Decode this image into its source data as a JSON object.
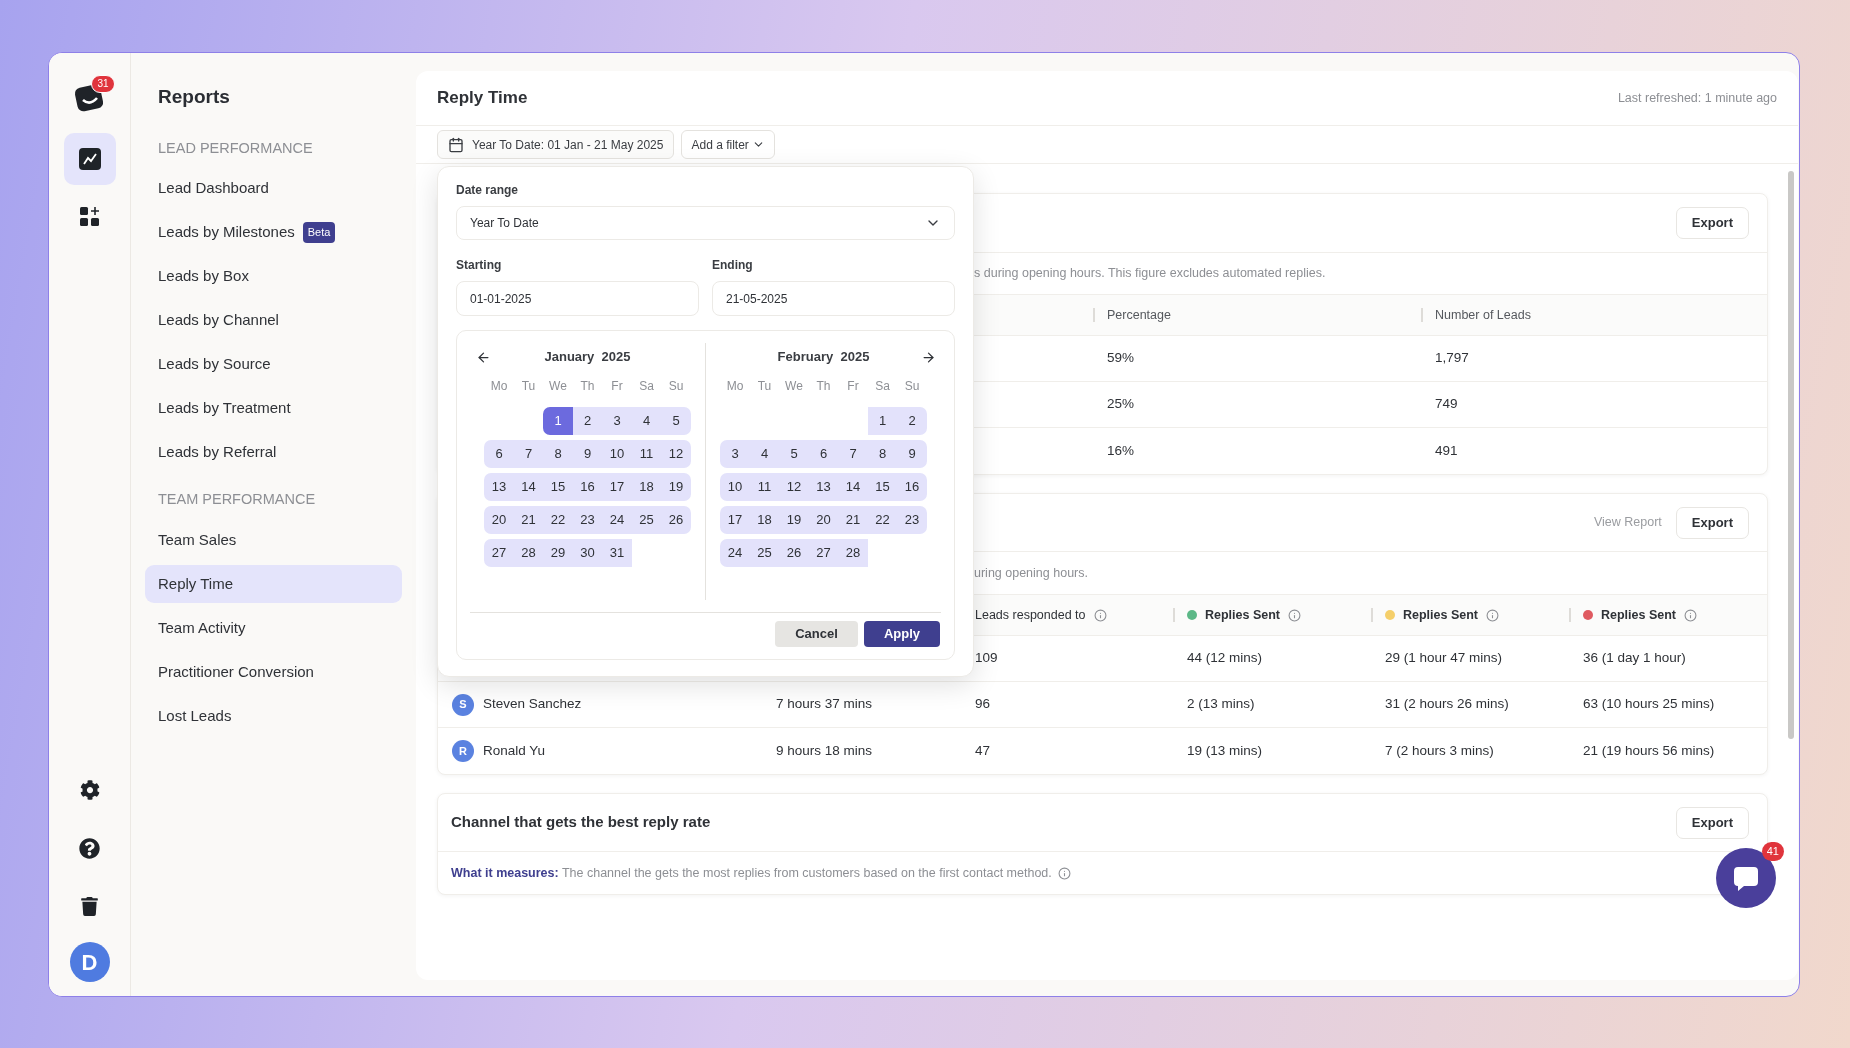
{
  "rail": {
    "logo_badge": "31",
    "items": [
      {
        "kind": "chart",
        "selected": true
      },
      {
        "kind": "apps",
        "selected": false
      }
    ],
    "bottom": [
      {
        "kind": "settings"
      },
      {
        "kind": "help"
      },
      {
        "kind": "trash"
      }
    ],
    "avatar": "D"
  },
  "sidebar": {
    "title": "Reports",
    "sections": [
      {
        "heading": "LEAD PERFORMANCE",
        "items": [
          {
            "label": "Lead Dashboard",
            "selected": false
          },
          {
            "label": "Leads by Milestones",
            "selected": false,
            "badge": "Beta"
          },
          {
            "label": "Leads by Box",
            "selected": false
          },
          {
            "label": "Leads by Channel",
            "selected": false
          },
          {
            "label": "Leads by Source",
            "selected": false
          },
          {
            "label": "Leads by Treatment",
            "selected": false
          },
          {
            "label": "Leads by Referral",
            "selected": false
          }
        ]
      },
      {
        "heading": "TEAM PERFORMANCE",
        "items": [
          {
            "label": "Team Sales",
            "selected": false
          },
          {
            "label": "Reply Time",
            "selected": true
          },
          {
            "label": "Team Activity",
            "selected": false
          },
          {
            "label": "Practitioner Conversion",
            "selected": false
          },
          {
            "label": "Lost Leads",
            "selected": false
          }
        ]
      }
    ]
  },
  "main": {
    "title": "Reply Time",
    "last_refreshed": "Last refreshed: 1 minute ago",
    "date_filter": "Year To Date: 01 Jan - 21 May 2025",
    "add_filter": "Add a filter"
  },
  "date_popover": {
    "range_label": "Date range",
    "range_value": "Year To Date",
    "starting_label": "Starting",
    "starting_value": "01-01-2025",
    "ending_label": "Ending",
    "ending_value": "21-05-2025",
    "cancel": "Cancel",
    "apply": "Apply",
    "months": [
      {
        "title": "January  2025",
        "weekdays": [
          "Mo",
          "Tu",
          "We",
          "Th",
          "Fr",
          "Sa",
          "Su"
        ],
        "weeks": [
          {
            "kind": "leading",
            "days": [
              {
                "label": "1",
                "selected": true
              },
              {
                "label": "2",
                "selected": false
              },
              {
                "label": "3",
                "selected": false
              },
              {
                "label": "4",
                "selected": false
              },
              {
                "label": "5",
                "selected": false
              }
            ]
          },
          {
            "kind": "full",
            "days": [
              {
                "label": "6",
                "selected": false
              },
              {
                "label": "7",
                "selected": false
              },
              {
                "label": "8",
                "selected": false
              },
              {
                "label": "9",
                "selected": false
              },
              {
                "label": "10",
                "selected": false
              },
              {
                "label": "11",
                "selected": false
              },
              {
                "label": "12",
                "selected": false
              }
            ]
          },
          {
            "kind": "full",
            "days": [
              {
                "label": "13",
                "selected": false
              },
              {
                "label": "14",
                "selected": false
              },
              {
                "label": "15",
                "selected": false
              },
              {
                "label": "16",
                "selected": false
              },
              {
                "label": "17",
                "selected": false
              },
              {
                "label": "18",
                "selected": false
              },
              {
                "label": "19",
                "selected": false
              }
            ]
          },
          {
            "kind": "full",
            "days": [
              {
                "label": "20",
                "selected": false
              },
              {
                "label": "21",
                "selected": false
              },
              {
                "label": "22",
                "selected": false
              },
              {
                "label": "23",
                "selected": false
              },
              {
                "label": "24",
                "selected": false
              },
              {
                "label": "25",
                "selected": false
              },
              {
                "label": "26",
                "selected": false
              }
            ]
          },
          {
            "kind": "trailing",
            "days": [
              {
                "label": "27",
                "selected": false
              },
              {
                "label": "28",
                "selected": false
              },
              {
                "label": "29",
                "selected": false
              },
              {
                "label": "30",
                "selected": false
              },
              {
                "label": "31",
                "selected": false
              }
            ]
          }
        ]
      },
      {
        "title": "February  2025",
        "weekdays": [
          "Mo",
          "Tu",
          "We",
          "Th",
          "Fr",
          "Sa",
          "Su"
        ],
        "weeks": [
          {
            "kind": "leading",
            "days": [
              {
                "label": "1",
                "selected": false
              },
              {
                "label": "2",
                "selected": false
              }
            ]
          },
          {
            "kind": "full",
            "days": [
              {
                "label": "3",
                "selected": false
              },
              {
                "label": "4",
                "selected": false
              },
              {
                "label": "5",
                "selected": false
              },
              {
                "label": "6",
                "selected": false
              },
              {
                "label": "7",
                "selected": false
              },
              {
                "label": "8",
                "selected": false
              },
              {
                "label": "9",
                "selected": false
              }
            ]
          },
          {
            "kind": "full",
            "days": [
              {
                "label": "10",
                "selected": false
              },
              {
                "label": "11",
                "selected": false
              },
              {
                "label": "12",
                "selected": false
              },
              {
                "label": "13",
                "selected": false
              },
              {
                "label": "14",
                "selected": false
              },
              {
                "label": "15",
                "selected": false
              },
              {
                "label": "16",
                "selected": false
              }
            ]
          },
          {
            "kind": "full",
            "days": [
              {
                "label": "17",
                "selected": false
              },
              {
                "label": "18",
                "selected": false
              },
              {
                "label": "19",
                "selected": false
              },
              {
                "label": "20",
                "selected": false
              },
              {
                "label": "21",
                "selected": false
              },
              {
                "label": "22",
                "selected": false
              },
              {
                "label": "23",
                "selected": false
              }
            ]
          },
          {
            "kind": "trailing",
            "days": [
              {
                "label": "24",
                "selected": false
              },
              {
                "label": "25",
                "selected": false
              },
              {
                "label": "26",
                "selected": false
              },
              {
                "label": "27",
                "selected": false
              },
              {
                "label": "28",
                "selected": false
              }
            ]
          }
        ]
      }
    ]
  },
  "card_1": {
    "export": "Export",
    "description": "s during opening hours. This figure excludes automated replies.",
    "columns": [
      "Percentage",
      "Number of Leads"
    ],
    "rows": [
      [
        "59%",
        "1,797"
      ],
      [
        "25%",
        "749"
      ],
      [
        "16%",
        "491"
      ]
    ]
  },
  "card_2": {
    "view_report": "View Report",
    "export": "Export",
    "description": "uring opening hours.",
    "columns": [
      {
        "label": "Leads responded to"
      },
      {
        "label": "Replies Sent",
        "color": "#5cb887"
      },
      {
        "label": "Replies Sent",
        "color": "#f5cf6a"
      },
      {
        "label": "Replies Sent",
        "color": "#df5a60"
      }
    ],
    "rows": [
      {
        "cells": [
          "109",
          "44 (12 mins)",
          "29 (1 hour 47 mins)",
          "36 (1 day 1 hour)"
        ]
      },
      {
        "avatar": "S",
        "name": "Steven Sanchez",
        "time": "7 hours 37 mins",
        "cells": [
          "96",
          "2 (13 mins)",
          "31 (2 hours 26 mins)",
          "63 (10 hours 25 mins)"
        ]
      },
      {
        "avatar": "R",
        "name": "Ronald Yu",
        "time": "9 hours 18 mins",
        "cells": [
          "47",
          "19 (13 mins)",
          "7 (2 hours 3 mins)",
          "21 (19 hours 56 mins)"
        ]
      }
    ]
  },
  "card_3": {
    "title": "Channel that gets the best reply rate",
    "export": "Export",
    "measure_label": "What it measures:",
    "measure_text": "The channel the gets the most replies from customers based on the first contact method."
  },
  "chat": {
    "badge": "41"
  }
}
